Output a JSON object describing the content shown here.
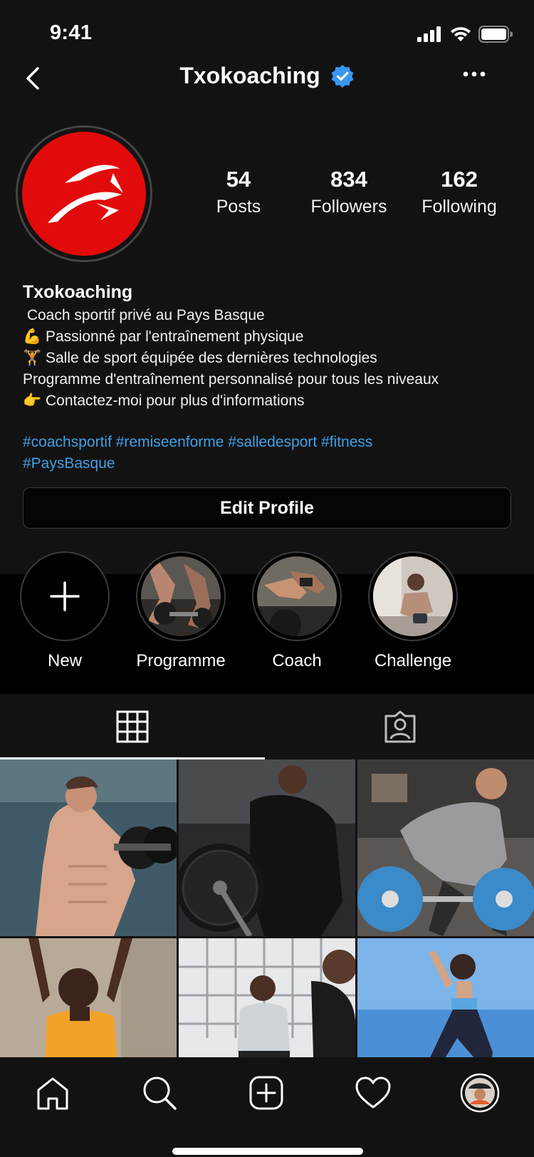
{
  "status": {
    "time": "9:41"
  },
  "header": {
    "title": "Txokoaching",
    "verified_icon": "verified-badge-icon"
  },
  "colors": {
    "accent_link": "#3ea0e6",
    "verified": "#3797f0",
    "avatar_bg": "#e10b0b"
  },
  "stats": [
    {
      "value": "54",
      "label": "Posts"
    },
    {
      "value": "834",
      "label": "Followers"
    },
    {
      "value": "162",
      "label": "Following"
    }
  ],
  "bio": {
    "name": "Txokoaching",
    "lines": [
      " Coach sportif privé au Pays Basque",
      "💪 Passionné par l'entraînement physique",
      "🏋 Salle de sport équipée des dernières technologies",
      "Programme d'entraînement personnalisé pour tous les niveaux",
      "👉 Contactez-moi pour plus d'informations"
    ],
    "hashtags_line1": "#coachsportif #remiseenforme #salledesport #fitness",
    "hashtags_line2": "#PaysBasque"
  },
  "edit_profile_label": "Edit Profile",
  "highlights": [
    {
      "label": "New"
    },
    {
      "label": "Programme"
    },
    {
      "label": "Coach"
    },
    {
      "label": "Challenge"
    }
  ],
  "tabs": [
    {
      "name": "posts-grid",
      "icon": "grid-icon",
      "active": true
    },
    {
      "name": "tagged",
      "icon": "tagged-person-icon",
      "active": false
    }
  ],
  "bottom_nav": [
    "home-icon",
    "search-icon",
    "add-post-icon",
    "heart-icon",
    "profile-avatar"
  ]
}
